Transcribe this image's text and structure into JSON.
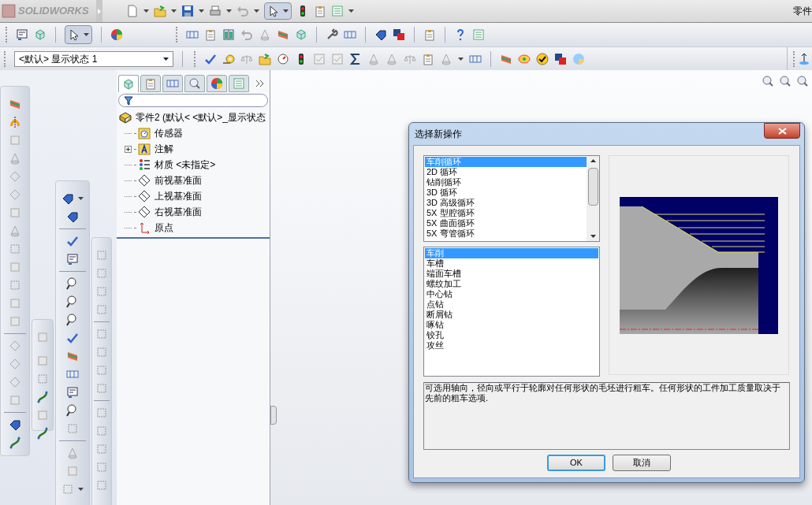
{
  "app": {
    "logo": "SOLIDWORKS",
    "document_title": "零件"
  },
  "display_state": {
    "value": "<默认> 显示状态 1"
  },
  "feature_manager": {
    "tabs": [
      {
        "selected": true
      },
      {
        "selected": false
      },
      {
        "selected": false
      },
      {
        "selected": false
      },
      {
        "selected": false
      },
      {
        "selected": false
      }
    ],
    "tree": {
      "label": "零件2  (默认< <默认>_显示状态",
      "kind": "part",
      "children": [
        {
          "label": "传感器",
          "kind": "sensors"
        },
        {
          "label": "注解",
          "kind": "annotations",
          "expanded": false
        },
        {
          "label": "材质 <未指定>",
          "kind": "material"
        },
        {
          "label": "前视基准面",
          "kind": "plane"
        },
        {
          "label": "上视基准面",
          "kind": "plane"
        },
        {
          "label": "右视基准面",
          "kind": "plane"
        },
        {
          "label": "原点",
          "kind": "origin"
        }
      ]
    }
  },
  "dialog": {
    "title": "选择新操作",
    "categories": [
      {
        "label": "车削循环",
        "selected": true
      },
      {
        "label": "2D 循环",
        "selected": false
      },
      {
        "label": "钻削循环",
        "selected": false
      },
      {
        "label": "3D 循环",
        "selected": false
      },
      {
        "label": "3D 高级循环",
        "selected": false
      },
      {
        "label": "5X 型腔循环",
        "selected": false
      },
      {
        "label": "5X 曲面循环",
        "selected": false
      },
      {
        "label": "5X 弯管循环",
        "selected": false
      }
    ],
    "operations": [
      {
        "label": "车削",
        "selected": true
      },
      {
        "label": "车槽",
        "selected": false
      },
      {
        "label": "端面车槽",
        "selected": false
      },
      {
        "label": "螺纹加工",
        "selected": false
      },
      {
        "label": "中心钻",
        "selected": false
      },
      {
        "label": "点钻",
        "selected": false
      },
      {
        "label": "断屑钻",
        "selected": false
      },
      {
        "label": "啄钻",
        "selected": false
      },
      {
        "label": "铰孔",
        "selected": false
      },
      {
        "label": "攻丝",
        "selected": false
      }
    ],
    "description": "可选用轴向，径向或平行于轮廓对任何形状的毛坯进行粗车。任何形状的工件加工质量取决于先前的粗车选项.",
    "buttons": [
      {
        "label": "OK",
        "default": true
      },
      {
        "label": "取消",
        "default": false
      }
    ]
  }
}
